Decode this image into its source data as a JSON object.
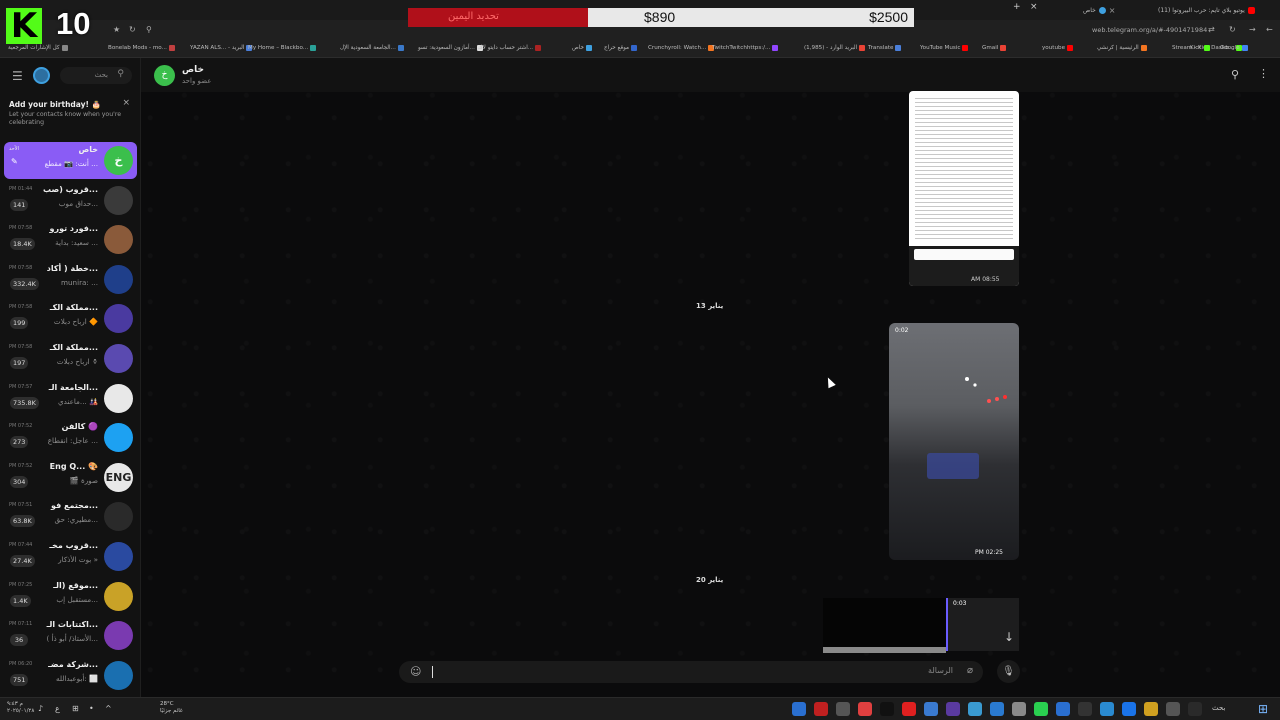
{
  "browser": {
    "tabs": [
      {
        "title": "خاص"
      },
      {
        "title": "(11) يوتيو بلاي تايم: حرب البيروتوا"
      }
    ],
    "url": "web.telegram.org/a/#-4901471984",
    "bookmarks": [
      {
        "label": "كل الإشارات المرجعية",
        "color": "#888888"
      },
      {
        "label": "Bonelab Mods - mo...",
        "color": "#c04040"
      },
      {
        "label": "YAZAN ALS... - البريد",
        "color": "#4a7ed8"
      },
      {
        "label": "My Home – Blackbo...",
        "color": "#2aa198"
      },
      {
        "label": "الجامعة السعودية الإل...",
        "color": "#3a78c8"
      },
      {
        "label": "أمازون السعودية: تسو...",
        "color": "#dddddd"
      },
      {
        "label": "اشتر حساب دايتو لاك...",
        "color": "#aa2222"
      },
      {
        "label": "خاص",
        "color": "#3ea0e0"
      },
      {
        "label": "موقع حراج",
        "color": "#3366cc"
      },
      {
        "label": "Crunchyroll: Watch...",
        "color": "#f47521"
      },
      {
        "label": "TwitchTwitchhttps:/...",
        "color": "#9146ff"
      },
      {
        "label": "(1,985) - البريد الوارد",
        "color": "#ea4335"
      },
      {
        "label": "Translate",
        "color": "#4a7ed8"
      },
      {
        "label": "YouTube Music",
        "color": "#ff0000"
      },
      {
        "label": "Gmail",
        "color": "#ea4335"
      },
      {
        "label": "youtube",
        "color": "#ff0000"
      },
      {
        "label": "الرئيسية | كرنشي",
        "color": "#f47521"
      },
      {
        "label": "Stream - Kick Dashb...",
        "color": "#53fc18"
      },
      {
        "label": "Kick",
        "color": "#53fc18"
      },
      {
        "label": "Google",
        "color": "#4285f4"
      }
    ]
  },
  "overlay": {
    "kick_count": "10",
    "goal_title": "تحديد اليمين",
    "goal_current": "$890",
    "goal_target": "$2500",
    "goal_progress": 0.356,
    "brand_color": "#53fc18"
  },
  "left": {
    "search_placeholder": "بحث",
    "birthday_title": "Add your birthday! 🎂",
    "birthday_sub": "Let your contacts know when you're celebrating",
    "chats": [
      {
        "title": "خاص",
        "preview": "أنت: 📷 مقطع ...",
        "time": "الأحد",
        "badge": "",
        "avatar": "خ",
        "avatar_color": "#3bbf4c",
        "active": true
      },
      {
        "title": "قروب (صب...",
        "preview": "حداق موب...",
        "time": "PM 01:44",
        "badge": "141",
        "avatar": "",
        "avatar_color": "#3a3a3a",
        "active": false
      },
      {
        "title": "فورد تورو...",
        "preview": "سعيد: بداية ...",
        "time": "PM 07:58",
        "badge": "18.4K",
        "avatar": "",
        "avatar_color": "#8a5a3a",
        "active": false
      },
      {
        "title": "خطة ( أكاد...",
        "preview": "munira: ...",
        "time": "PM 07:58",
        "badge": "332.4K",
        "avatar": "",
        "avatar_color": "#1f3f8a",
        "active": false
      },
      {
        "title": "مملكة الكـ...",
        "preview": "ارباح دبلات 🔶",
        "time": "PM 07:58",
        "badge": "199",
        "avatar": "",
        "avatar_color": "#4a3aa0",
        "active": false
      },
      {
        "title": "مملكة الكـ...",
        "preview": "ارباح دبلات ⚱",
        "time": "PM 07:58",
        "badge": "197",
        "avatar": "",
        "avatar_color": "#5a4ab0",
        "active": false
      },
      {
        "title": "الجامعة الـ...",
        "preview": "ماعندي... 🎎",
        "time": "PM 07:57",
        "badge": "735.8K",
        "avatar": "",
        "avatar_color": "#e8e8e8",
        "active": false
      },
      {
        "title": "كالفن 🟣",
        "preview": "عاجل: انقطاع ...",
        "time": "PM 07:52",
        "badge": "273",
        "avatar": "",
        "avatar_color": "#1da1f2",
        "active": false
      },
      {
        "title": "Eng Q... 🎨",
        "preview": "🎬 صورة",
        "time": "PM 07:52",
        "badge": "304",
        "avatar": "ENG",
        "avatar_color": "#e8e8e8",
        "active": false
      },
      {
        "title": "مجتمع فو...",
        "preview": "مطيري: حق...",
        "time": "PM 07:51",
        "badge": "63.8K",
        "avatar": "",
        "avatar_color": "#2a2a2a",
        "active": false
      },
      {
        "title": "قروب مخـ...",
        "preview": "بوت الأذكار »",
        "time": "PM 07:44",
        "badge": "27.4K",
        "avatar": "",
        "avatar_color": "#2a4aa0",
        "active": false
      },
      {
        "title": "موقع (الـ...",
        "preview": "مستقبل إب...",
        "time": "PM 07:25",
        "badge": "1.4K",
        "avatar": "",
        "avatar_color": "#c9a227",
        "active": false
      },
      {
        "title": "اكتتابات الـ...",
        "preview": "( الأستاذ/ أبو ذأ...",
        "time": "PM 07:11",
        "badge": "36",
        "avatar": "",
        "avatar_color": "#7a3ab0",
        "active": false
      },
      {
        "title": "شركة مضـ...",
        "preview": "أبوعبدالله: ⬜",
        "time": "PM 06:20",
        "badge": "751",
        "avatar": "",
        "avatar_color": "#1a6fb0",
        "active": false
      }
    ]
  },
  "chat": {
    "title": "خاص",
    "subtitle": "عضو واحد",
    "avatar": "خ",
    "messages": {
      "doc_time": "AM 08:55",
      "date1": "13 يناير",
      "video_duration": "0:02",
      "video_time": "PM 02:25",
      "date2": "20 يناير",
      "video2_duration": "0:03"
    },
    "composer_placeholder": "الرسالة"
  },
  "taskbar": {
    "clock": "م ٩:٤٣",
    "date": "٢٠٢٥/٠١/٢٨",
    "weather_temp": "28°C",
    "weather_desc": "غائم جزئيًا",
    "search_label": "بحث"
  }
}
